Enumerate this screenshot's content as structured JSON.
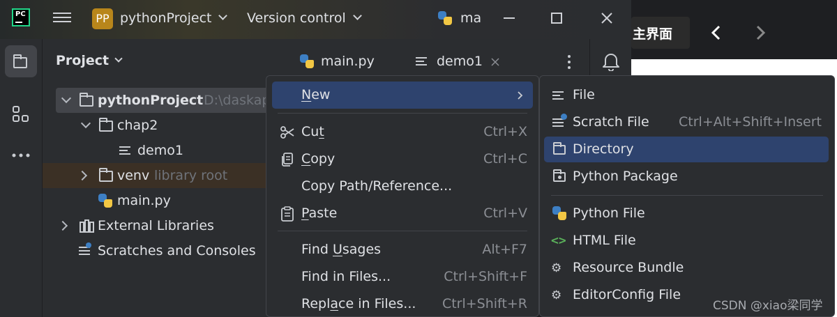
{
  "titlebar": {
    "project_badge": "PP",
    "project_name": "pythonProject",
    "vcs_label": "Version control",
    "run_file": "ma"
  },
  "external_window": {
    "title": "主界面"
  },
  "project_panel": {
    "title": "Project",
    "tree": [
      {
        "label": "pythonProject",
        "hint": "D:\\daskap",
        "icon": "folder-icon"
      },
      {
        "label": "chap2",
        "hint": "",
        "icon": "folder-icon"
      },
      {
        "label": "demo1",
        "hint": "",
        "icon": "text-file-icon"
      },
      {
        "label": "venv",
        "hint": "library root",
        "icon": "folder-icon"
      },
      {
        "label": "main.py",
        "hint": "",
        "icon": "python-file-icon"
      },
      {
        "label": "External Libraries",
        "hint": "",
        "icon": "library-icon"
      },
      {
        "label": "Scratches and Consoles",
        "hint": "",
        "icon": "scratch-icon"
      }
    ]
  },
  "editor_tabs": [
    {
      "label": "main.py",
      "icon": "python-file-icon"
    },
    {
      "label": "demo1",
      "icon": "text-file-icon"
    }
  ],
  "context_menu": {
    "items": [
      {
        "pre": "",
        "u": "N",
        "post": "ew",
        "shortcut": "",
        "icon": ""
      },
      {
        "pre": "Cu",
        "u": "t",
        "post": "",
        "shortcut": "Ctrl+X",
        "icon": "scissors-icon"
      },
      {
        "pre": "",
        "u": "C",
        "post": "opy",
        "shortcut": "Ctrl+C",
        "icon": "copy-icon"
      },
      {
        "pre": "Copy Path/Reference...",
        "u": "",
        "post": "",
        "shortcut": "",
        "icon": ""
      },
      {
        "pre": "",
        "u": "P",
        "post": "aste",
        "shortcut": "Ctrl+V",
        "icon": "paste-icon"
      },
      {
        "pre": "Find ",
        "u": "U",
        "post": "sages",
        "shortcut": "Alt+F7",
        "icon": ""
      },
      {
        "pre": "Find in Files...",
        "u": "",
        "post": "",
        "shortcut": "Ctrl+Shift+F",
        "icon": ""
      },
      {
        "pre": "Repl",
        "u": "a",
        "post": "ce in Files...",
        "shortcut": "Ctrl+Shift+R",
        "icon": ""
      }
    ]
  },
  "submenu": {
    "items": [
      {
        "label": "File",
        "shortcut": "",
        "icon": "text-file-icon"
      },
      {
        "label": "Scratch File",
        "shortcut": "Ctrl+Alt+Shift+Insert",
        "icon": "scratch-file-icon"
      },
      {
        "label": "Directory",
        "shortcut": "",
        "icon": "folder-icon"
      },
      {
        "label": "Python Package",
        "shortcut": "",
        "icon": "package-icon"
      },
      {
        "label": "Python File",
        "shortcut": "",
        "icon": "python-file-icon"
      },
      {
        "label": "HTML File",
        "shortcut": "",
        "icon": "html-icon"
      },
      {
        "label": "Resource Bundle",
        "shortcut": "",
        "icon": "gear-icon"
      },
      {
        "label": "EditorConfig File",
        "shortcut": "",
        "icon": "gear-icon"
      }
    ]
  },
  "watermark": "CSDN @xiao梁同学",
  "colors": {
    "selection": "#2e436e",
    "panel_bg": "#2b2d30",
    "venv_row": "#3b3025",
    "pycharm_green": "#21d789",
    "badge": "#b8861b"
  }
}
